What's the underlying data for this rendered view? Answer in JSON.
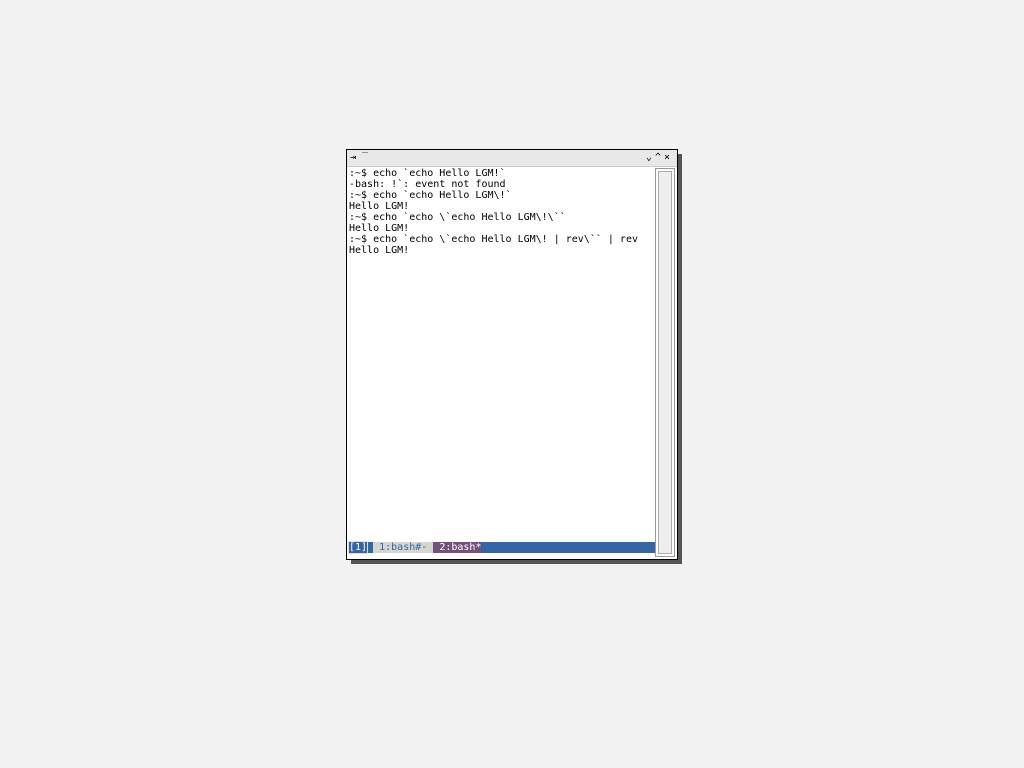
{
  "titlebar": {
    "left_icons": "⇥ ‾",
    "controls": [
      "⌄",
      "^",
      "×"
    ]
  },
  "terminal": {
    "lines": [
      ":~$ echo `echo Hello LGM!`",
      "-bash: !`: event not found",
      ":~$ echo `echo Hello LGM\\!`",
      "Hello LGM!",
      ":~$ echo `echo \\`echo Hello LGM\\!\\``",
      "Hello LGM!",
      ":~$ echo `echo \\`echo Hello LGM\\! | rev\\`` | rev",
      "Hello LGM!"
    ]
  },
  "status": {
    "session": "[1]",
    "window1": " 1:bash#- ",
    "window2": " 2:bash*"
  },
  "colors": {
    "status_bg": "#3465a4",
    "active_window": "#75507b"
  }
}
